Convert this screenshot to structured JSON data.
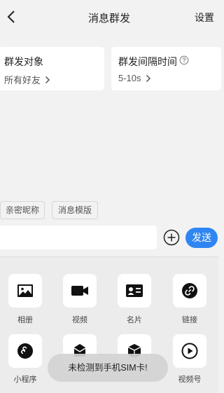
{
  "header": {
    "title": "消息群发",
    "settings_label": "设置"
  },
  "target_card": {
    "label": "群发对象",
    "value": "所有好友"
  },
  "interval_card": {
    "label": "群发间隔时间",
    "value": "5-10s"
  },
  "chips": [
    "亲密昵称",
    "消息模版"
  ],
  "composer": {
    "value": "",
    "placeholder": "",
    "send_label": "发送"
  },
  "attachments": [
    {
      "label": "相册",
      "icon": "image-icon"
    },
    {
      "label": "视频",
      "icon": "video-camera-icon"
    },
    {
      "label": "名片",
      "icon": "contact-card-icon"
    },
    {
      "label": "链接",
      "icon": "link-icon"
    },
    {
      "label": "小程序",
      "icon": "mini-program-icon"
    },
    {
      "label": "",
      "icon": "red-packet-icon"
    },
    {
      "label": "",
      "icon": "package-icon"
    },
    {
      "label": "视频号",
      "icon": "play-icon"
    }
  ],
  "toast": "未检测到手机SIM卡!",
  "colors": {
    "accent": "#2f86f2",
    "background": "#f2f2f2"
  }
}
